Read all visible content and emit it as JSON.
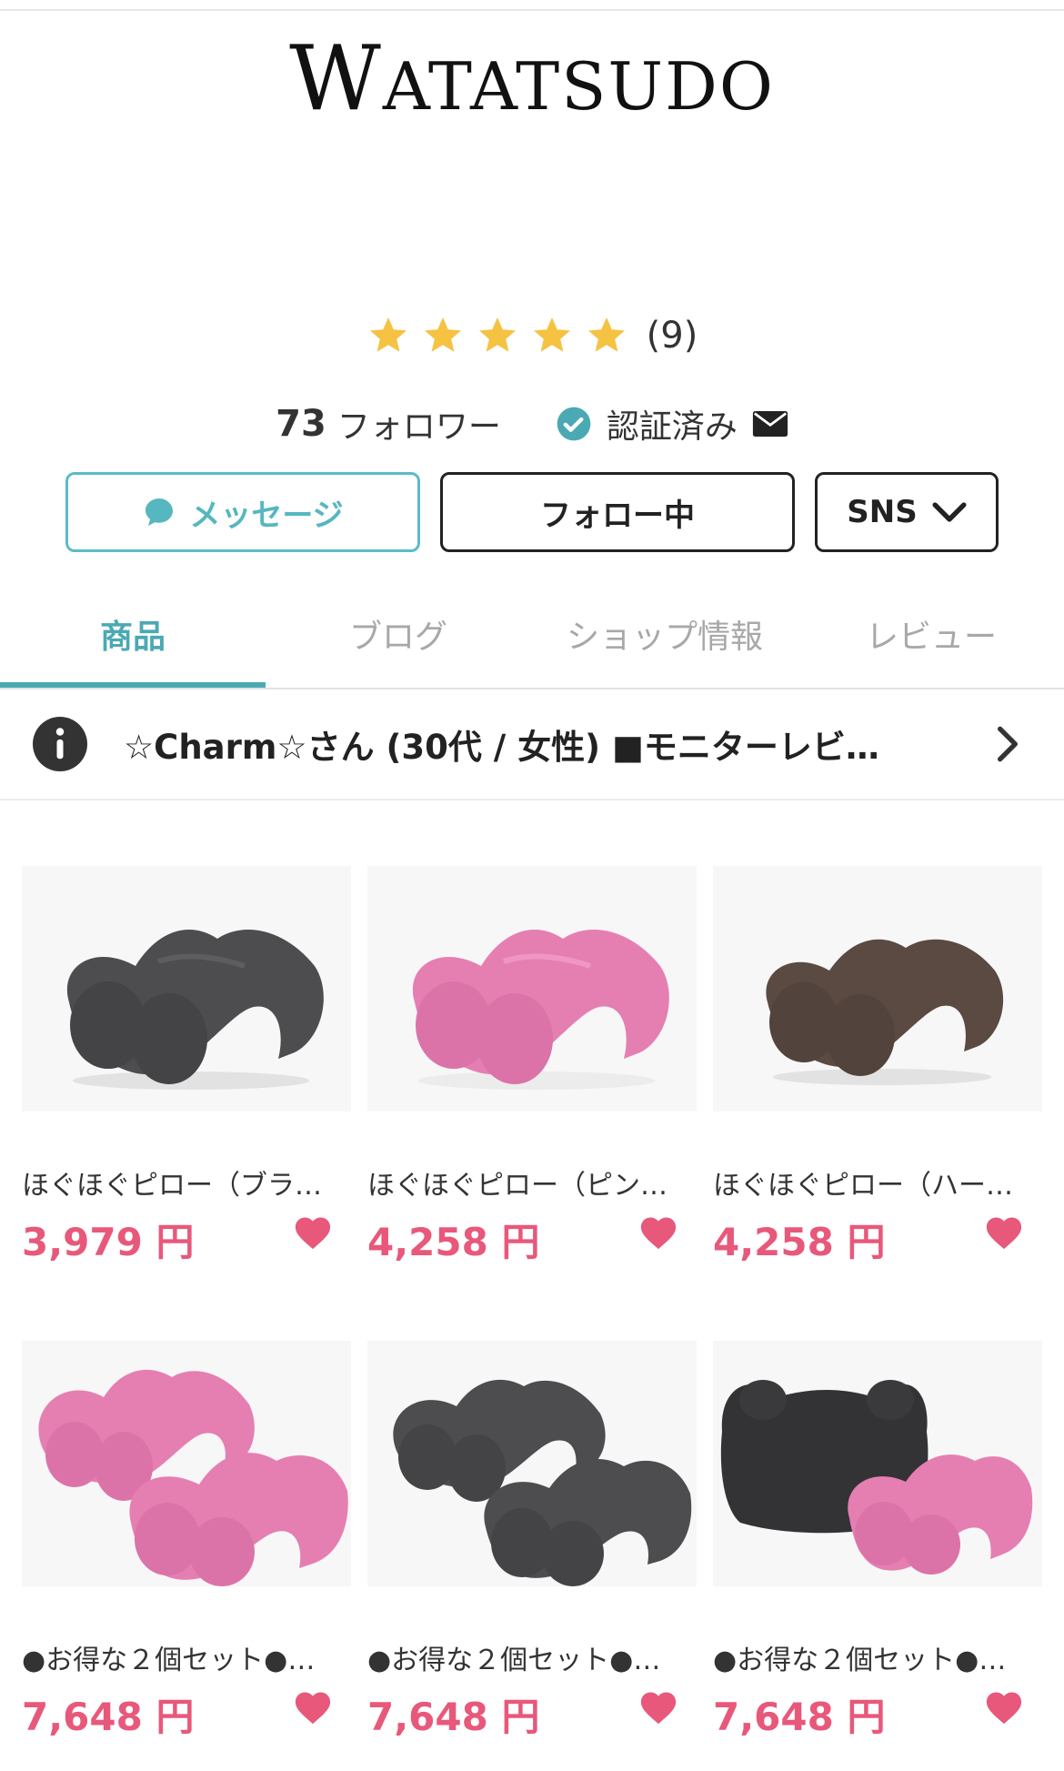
{
  "brand": {
    "logo_text": "WATATSUDO"
  },
  "rating": {
    "stars": 5,
    "count_label": "(9)",
    "star_color": "#f5c242"
  },
  "profile": {
    "followers_number": "73",
    "followers_label": "フォロワー",
    "verified_label": "認証済み"
  },
  "actions": {
    "message_label": "メッセージ",
    "follow_label": "フォロー中",
    "sns_label": "SNS"
  },
  "tabs": [
    {
      "label": "商品",
      "active": true
    },
    {
      "label": "ブログ",
      "active": false
    },
    {
      "label": "ショップ情報",
      "active": false
    },
    {
      "label": "レビュー",
      "active": false
    }
  ],
  "notice": {
    "text": "☆Charm☆さん (30代 / 女性) ■モニターレビ…"
  },
  "products": [
    {
      "name": "ほぐほぐピロー（ブラ…",
      "price": "3,979 円",
      "variant": "dark",
      "colors": [
        "#4d4d4f"
      ]
    },
    {
      "name": "ほぐほぐピロー（ピン…",
      "price": "4,258 円",
      "variant": "pink",
      "colors": [
        "#e57fb2"
      ]
    },
    {
      "name": "ほぐほぐピロー（ハー…",
      "price": "4,258 円",
      "variant": "brown",
      "colors": [
        "#5a4a42"
      ]
    },
    {
      "name": "●お得な２個セット●…",
      "price": "7,648 円",
      "variant": "pink-pair",
      "colors": [
        "#e57fb2",
        "#e57fb2"
      ]
    },
    {
      "name": "●お得な２個セット●…",
      "price": "7,648 円",
      "variant": "dark-pair",
      "colors": [
        "#4d4d4f",
        "#4d4d4f"
      ]
    },
    {
      "name": "●お得な２個セット●…",
      "price": "7,648 円",
      "variant": "mixed-pair",
      "colors": [
        "#333335",
        "#e57fb2"
      ]
    }
  ],
  "theme": {
    "accent": "#4ba9b3",
    "price_color": "#e8587a"
  }
}
